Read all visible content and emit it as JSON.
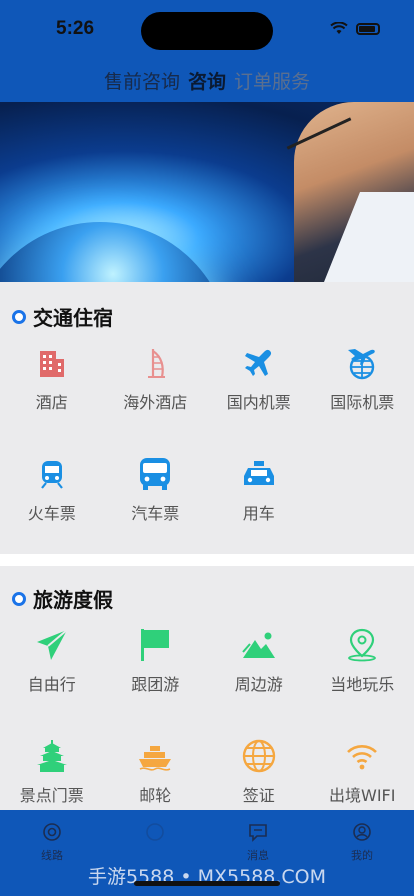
{
  "status": {
    "time": "5:26"
  },
  "header": {
    "tabs": [
      "售前咨询",
      "咨询",
      "订单服务"
    ]
  },
  "section1": {
    "title": "交通住宿",
    "items": [
      {
        "label": "酒店",
        "icon": "hotel-building-icon",
        "color": "#e06a6a"
      },
      {
        "label": "海外酒店",
        "icon": "burj-tower-icon",
        "color": "#e8908f"
      },
      {
        "label": "国内机票",
        "icon": "airplane-icon",
        "color": "#1a8fe3"
      },
      {
        "label": "国际机票",
        "icon": "globe-airplane-icon",
        "color": "#1a8fe3"
      },
      {
        "label": "火车票",
        "icon": "train-icon",
        "color": "#1a8fe3"
      },
      {
        "label": "汽车票",
        "icon": "bus-icon",
        "color": "#1a8fe3"
      },
      {
        "label": "用车",
        "icon": "taxi-icon",
        "color": "#1a8fe3"
      }
    ]
  },
  "section2": {
    "title": "旅游度假",
    "items": [
      {
        "label": "自由行",
        "icon": "paper-plane-icon",
        "color": "#2fd07a"
      },
      {
        "label": "跟团游",
        "icon": "flag-icon",
        "color": "#2fd07a"
      },
      {
        "label": "周边游",
        "icon": "mountain-icon",
        "color": "#2fd07a"
      },
      {
        "label": "当地玩乐",
        "icon": "location-pin-icon",
        "color": "#2fd07a"
      },
      {
        "label": "景点门票",
        "icon": "temple-icon",
        "color": "#2fd07a"
      },
      {
        "label": "邮轮",
        "icon": "cruise-ship-icon",
        "color": "#f5a740"
      },
      {
        "label": "签证",
        "icon": "globe-icon",
        "color": "#f5a740"
      },
      {
        "label": "出境WIFI",
        "icon": "wifi-icon",
        "color": "#f5a740"
      }
    ]
  },
  "tabbar": {
    "tabs": [
      "线路",
      "",
      "消息",
      "我的"
    ]
  },
  "watermark": "手游5588 • MX5588.COM"
}
